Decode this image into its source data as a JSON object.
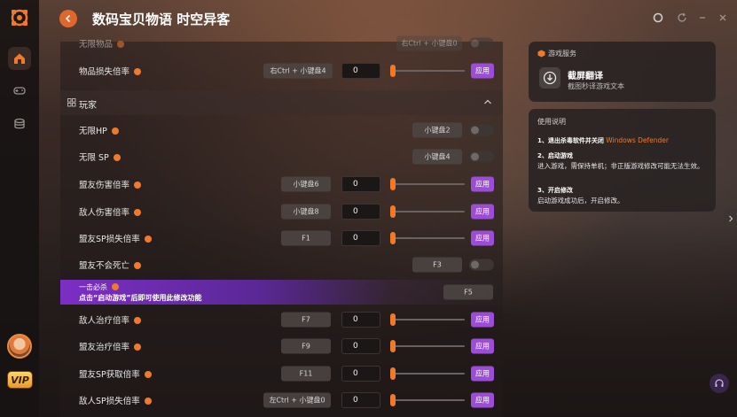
{
  "header": {
    "title": "数码宝贝物语 时空异客"
  },
  "sidebar": {
    "vip_label": "VIP",
    "icons": [
      "logo-icon",
      "home-icon",
      "gamepad-icon",
      "database-icon"
    ]
  },
  "rows_top": [
    {
      "label": "无限物品",
      "key": "右Ctrl + 小键盘0",
      "type": "toggle"
    },
    {
      "label": "物品损失倍率",
      "key": "右Ctrl + 小键盘4",
      "value": "0",
      "apply": "应用",
      "type": "slider"
    }
  ],
  "section": {
    "title": "玩家"
  },
  "rows": [
    {
      "label": "无限HP",
      "key": "小键盘2",
      "type": "toggle"
    },
    {
      "label": "无限 SP",
      "key": "小键盘4",
      "type": "toggle"
    },
    {
      "label": "盟友伤害倍率",
      "key": "小键盘6",
      "value": "0",
      "apply": "应用",
      "type": "slider"
    },
    {
      "label": "敌人伤害倍率",
      "key": "小键盘8",
      "value": "0",
      "apply": "应用",
      "type": "slider"
    },
    {
      "label": "盟友SP损失倍率",
      "key": "F1",
      "value": "0",
      "apply": "应用",
      "type": "slider"
    },
    {
      "label": "盟友不会死亡",
      "key": "F3",
      "type": "toggle"
    }
  ],
  "oneclick": {
    "title": "一击必杀",
    "note": "点击“启动游戏”后即可使用此修改功能",
    "key": "F5"
  },
  "rows_bottom": [
    {
      "label": "敌人治疗倍率",
      "key": "F7",
      "value": "0",
      "apply": "应用"
    },
    {
      "label": "盟友治疗倍率",
      "key": "F9",
      "value": "0",
      "apply": "应用"
    },
    {
      "label": "盟友SP获取倍率",
      "key": "F11",
      "value": "0",
      "apply": "应用"
    },
    {
      "label": "敌人SP损失倍率",
      "key": "左Ctrl + 小键盘0",
      "value": "0",
      "apply": "应用"
    }
  ],
  "service": {
    "header": "游戏服务",
    "name": "截屏翻译",
    "desc": "截图秒译游戏文本"
  },
  "instructions": {
    "header": "使用说明",
    "step1_title": "1、退出杀毒软件并关闭",
    "step1_highlight": "Windows Defender",
    "step2_title": "2、启动游戏",
    "step2_body": "进入游戏，需保持单机；非正版游戏修改可能无法生效。",
    "step3_title": "3、开启修改",
    "step3_body": "启动游戏成功后，开启修改。"
  },
  "colors": {
    "accent_orange": "#f07a2a",
    "apply_purple": "#9b4dd8",
    "oneclick_purple": "#7b2fc4"
  }
}
